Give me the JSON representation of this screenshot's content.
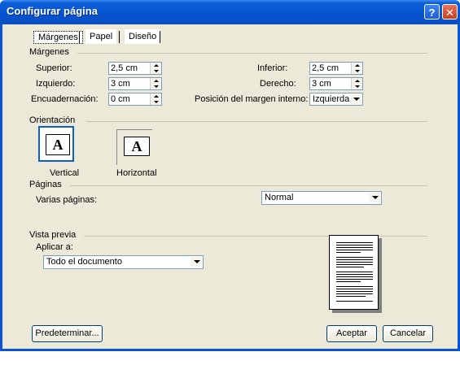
{
  "window": {
    "title": "Configurar página",
    "help_glyph": "?",
    "close_glyph": "✕"
  },
  "tabs": [
    {
      "label": "Márgenes"
    },
    {
      "label": "Papel"
    },
    {
      "label": "Diseño"
    }
  ],
  "margins": {
    "group_label": "Márgenes",
    "superior_label": "Superior:",
    "superior_value": "2,5 cm",
    "izquierdo_label": "Izquierdo:",
    "izquierdo_value": "3 cm",
    "encuadernacion_label": "Encuadernación:",
    "encuadernacion_value": "0 cm",
    "inferior_label": "Inferior:",
    "inferior_value": "2,5 cm",
    "derecho_label": "Derecho:",
    "derecho_value": "3 cm",
    "posicion_label": "Posición del margen interno:",
    "posicion_value": "Izquierda"
  },
  "orientation": {
    "group_label": "Orientación",
    "vertical_label": "Vertical",
    "horizontal_label": "Horizontal",
    "page_glyph": "A",
    "selected": "vertical"
  },
  "pages": {
    "group_label": "Páginas",
    "varias_label": "Varias páginas:",
    "varias_value": "Normal"
  },
  "preview": {
    "group_label": "Vista previa",
    "aplicar_label": "Aplicar a:",
    "aplicar_value": "Todo el documento"
  },
  "buttons": {
    "default_label": "Predeterminar...",
    "ok_label": "Aceptar",
    "cancel_label": "Cancelar"
  }
}
